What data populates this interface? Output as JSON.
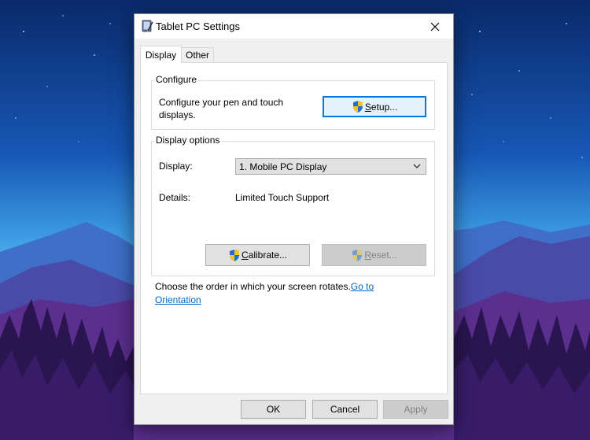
{
  "dialog": {
    "title": "Tablet PC Settings",
    "tabs": [
      {
        "label": "Display",
        "active": true
      },
      {
        "label": "Other",
        "active": false
      }
    ]
  },
  "configure": {
    "caption": "Configure",
    "description_line1": "Configure your pen and touch",
    "description_line2": "displays.",
    "setup_button": {
      "underline": "S",
      "rest": "etup..."
    }
  },
  "display_options": {
    "caption": "Display options",
    "display_label": "Display:",
    "display_value": "1. Mobile PC Display",
    "details_label": "Details:",
    "details_value": "Limited Touch Support",
    "calibrate_button": {
      "underline": "C",
      "rest": "alibrate..."
    },
    "reset_button": {
      "underline": "R",
      "rest": "eset..."
    }
  },
  "rotation": {
    "text": "Choose the order in which your screen rotates.",
    "link_part1": "Go to",
    "link_part2": "Orientation"
  },
  "footer": {
    "ok": "OK",
    "cancel": "Cancel",
    "apply": "Apply"
  },
  "colors": {
    "accent": "#0078d7",
    "link": "#0066cc",
    "dialog_bg": "#f0f0f0",
    "disabled_text": "#838383"
  },
  "icons": [
    "tablet-pc-settings-icon",
    "close-icon",
    "uac-shield-icon",
    "chevron-down-icon"
  ]
}
